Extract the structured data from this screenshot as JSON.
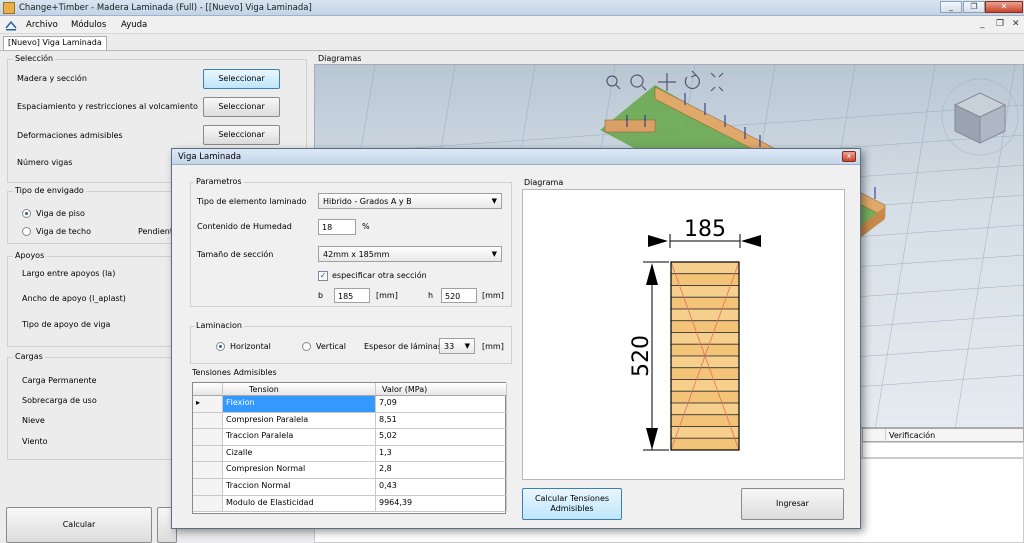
{
  "window": {
    "title": "Change+Timber - Madera Laminada (Full) - [[Nuevo] Viga Laminada]",
    "controls": [
      "_",
      "❐",
      "✕"
    ]
  },
  "menu": {
    "items": [
      "Archivo",
      "Módulos",
      "Ayuda"
    ],
    "mdi_controls": [
      "_",
      "❐",
      "✕"
    ]
  },
  "doc_tab": "[Nuevo] Viga Laminada",
  "left": {
    "seleccion": {
      "title": "Selección",
      "rows": [
        {
          "label": "Madera y sección",
          "button": "Seleccionar"
        },
        {
          "label": "Espaciamiento y restricciones al volcamiento",
          "button": "Seleccionar"
        },
        {
          "label": "Deformaciones admisibles",
          "button": "Seleccionar"
        },
        {
          "label": "Número vigas"
        }
      ]
    },
    "envigado": {
      "title": "Tipo de envigado",
      "options": [
        "Viga de piso",
        "Viga de techo"
      ],
      "selected": 0,
      "pendiente": "Pendiente"
    },
    "apoyos": {
      "title": "Apoyos",
      "rows": [
        "Largo entre apoyos (la)",
        "Ancho de apoyo (l_aplast)",
        "Tipo de apoyo de viga"
      ]
    },
    "cargas": {
      "title": "Cargas",
      "rows": [
        "Carga Permanente",
        "Sobrecarga de uso",
        "Nieve",
        "Viento"
      ]
    },
    "calcular": "Calcular"
  },
  "diagramas": {
    "label": "Diagramas",
    "toolbar_icons": [
      "zoom-box-icon",
      "zoom-icon",
      "pan-icon",
      "rotate-icon",
      "fit-icon"
    ]
  },
  "verificacion": {
    "header": "Verificación"
  },
  "dialog": {
    "title": "Viga Laminada",
    "close": "x",
    "parametros": {
      "title": "Parametros",
      "tipo_label": "Tipo de elemento laminado",
      "tipo_value": "Hibrido - Grados A y B",
      "humedad_label": "Contenido de Humedad",
      "humedad_value": "18",
      "humedad_unit": "%",
      "tamano_label": "Tamaño de sección",
      "tamano_value": "42mm x 185mm",
      "especificar_label": "especificar otra sección",
      "especificar_checked": true,
      "b_label": "b",
      "b_value": "185",
      "b_unit": "[mm]",
      "h_label": "h",
      "h_value": "520",
      "h_unit": "[mm]"
    },
    "laminacion": {
      "title": "Laminacion",
      "options": [
        "Horizontal",
        "Vertical"
      ],
      "selected": 0,
      "espesor_label": "Espesor de láminas",
      "espesor_value": "33",
      "espesor_unit": "[mm]"
    },
    "tensiones": {
      "title": "Tensiones Admisibles",
      "columns": [
        "Tension",
        "Valor (MPa)"
      ],
      "rows": [
        {
          "tension": "Flexion",
          "valor": "7,09"
        },
        {
          "tension": "Compresion Paralela",
          "valor": "8,51"
        },
        {
          "tension": "Traccion Paralela",
          "valor": "5,02"
        },
        {
          "tension": "Cizalle",
          "valor": "1,3"
        },
        {
          "tension": "Compresion Normal",
          "valor": "2,8"
        },
        {
          "tension": "Traccion Normal",
          "valor": "0,43"
        },
        {
          "tension": "Modulo de Elasticidad",
          "valor": "9964,39"
        }
      ]
    },
    "diagrama": {
      "title": "Diagrama",
      "width_label": "185",
      "height_label": "520",
      "lamina_count": 16
    },
    "buttons": {
      "calcular": "Calcular Tensiones Admisibles",
      "ingresar": "Ingresar"
    }
  }
}
